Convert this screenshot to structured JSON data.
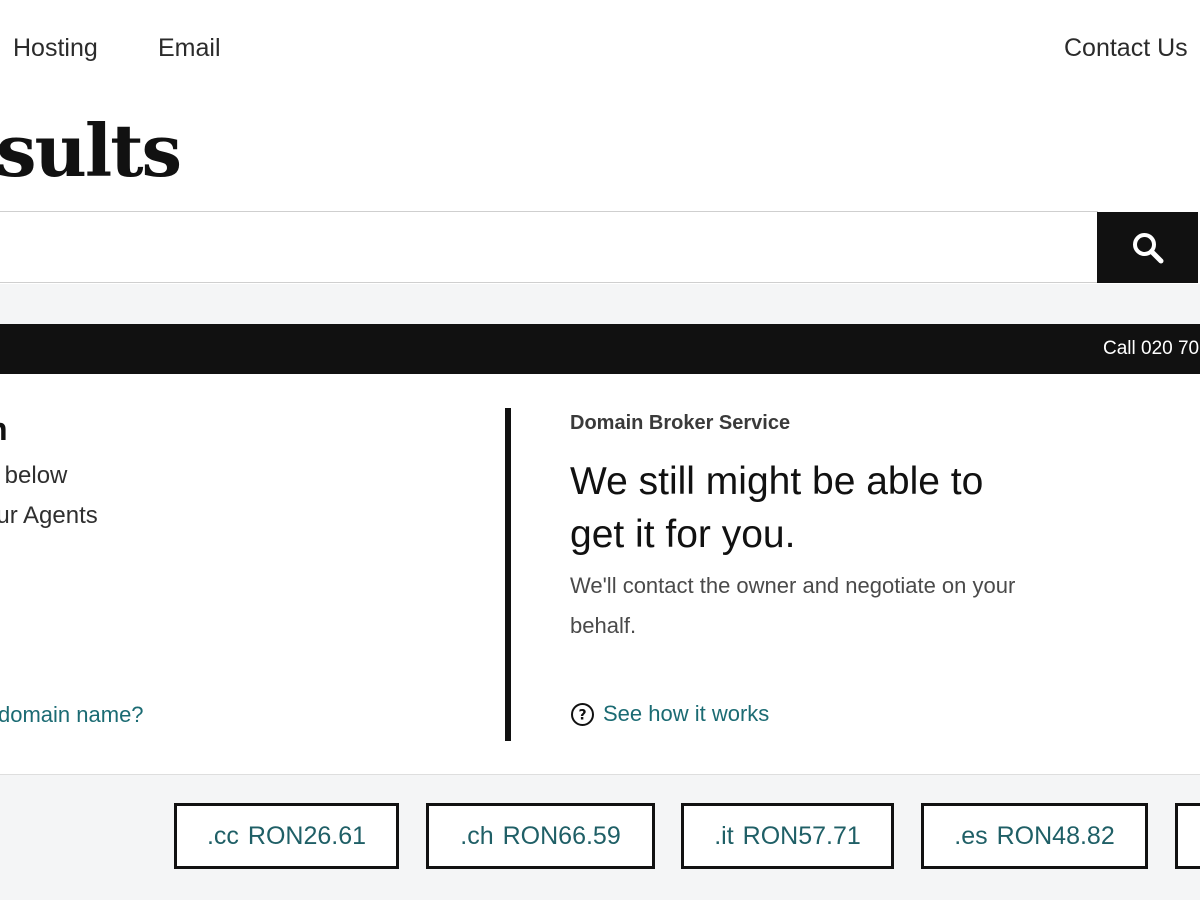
{
  "nav": {
    "hosting": "Hosting",
    "email": "Email",
    "contact": "Contact Us"
  },
  "page_title": "sults",
  "search": {
    "value": "",
    "placeholder": "",
    "button_icon": "search-icon"
  },
  "promo_bar": {
    "call_text": "Call 020 70"
  },
  "left_panel": {
    "heading": "n",
    "line1": "s below",
    "line2": "our Agents",
    "link": "domain name?"
  },
  "broker": {
    "label": "Domain Broker Service",
    "headline": "We still might be able to get it for you.",
    "description": "We'll contact the owner and negotiate on your behalf.",
    "link": "See how it works",
    "link_icon": "question-circle-icon"
  },
  "tld_suggestions": [
    {
      "tld": ".cc",
      "price": "RON26.61"
    },
    {
      "tld": ".ch",
      "price": "RON66.59"
    },
    {
      "tld": ".it",
      "price": "RON57.71"
    },
    {
      "tld": ".es",
      "price": "RON48.82"
    }
  ],
  "colors": {
    "accent_link": "#1b6b73",
    "dark": "#111111",
    "band_background": "#f4f5f6"
  }
}
